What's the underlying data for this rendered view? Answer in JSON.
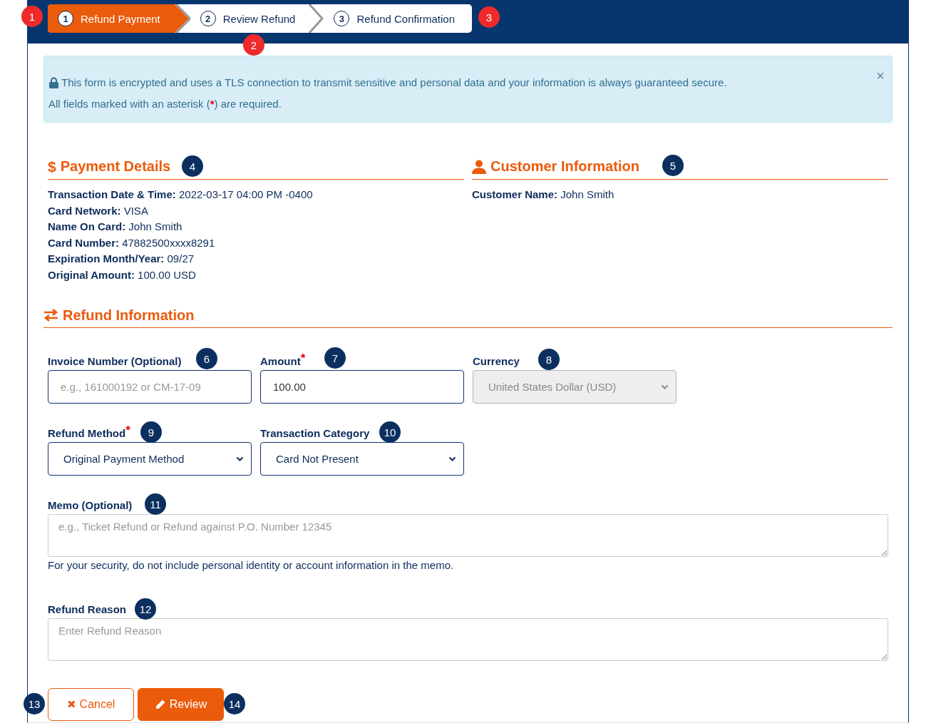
{
  "steps": [
    {
      "number": "1",
      "label": "Refund Payment",
      "selected": true
    },
    {
      "number": "2",
      "label": "Review Refund",
      "selected": false
    },
    {
      "number": "3",
      "label": "Refund Confirmation",
      "selected": false
    }
  ],
  "alert": {
    "text": "This form is encrypted and uses a TLS connection to transmit sensitive and personal data and your information is always guaranteed secure.",
    "required_before": "All fields marked with an asterisk (",
    "required_mark": "*",
    "required_after": ") are required.",
    "close": "×"
  },
  "payment_details": {
    "icon": "$",
    "title": "Payment Details",
    "rows": [
      {
        "label": "Transaction Date & Time:",
        "value": "2022-03-17 04:00 PM -0400"
      },
      {
        "label": "Card Network:",
        "value": "VISA"
      },
      {
        "label": "Name On Card:",
        "value": "John Smith"
      },
      {
        "label": "Card Number:",
        "value": "47882500xxxx8291"
      },
      {
        "label": "Expiration Month/Year:",
        "value": "09/27"
      },
      {
        "label": "Original Amount:",
        "value": "100.00 USD"
      }
    ]
  },
  "customer_information": {
    "title": "Customer Information",
    "rows": [
      {
        "label": "Customer Name:",
        "value": "John Smith"
      }
    ]
  },
  "refund_information": {
    "title": "Refund Information"
  },
  "field_rows": [
    [
      {
        "kind": "input",
        "label": "Invoice Number (Optional)",
        "required": false,
        "placeholder": "e.g., 161000192 or CM-17-09"
      },
      {
        "kind": "input",
        "label": "Amount",
        "required": true,
        "value": "100.00"
      },
      {
        "kind": "select",
        "label": "Currency",
        "required": false,
        "value": "United States Dollar (USD)",
        "disabled": true
      }
    ],
    [
      {
        "kind": "select",
        "label": "Refund Method",
        "required": true,
        "value": "Original Payment Method",
        "disabled": false
      },
      {
        "kind": "select",
        "label": "Transaction Category",
        "required": false,
        "value": "Card Not Present",
        "disabled": false
      }
    ],
    [
      {
        "kind": "textarea",
        "label": "Memo (Optional)",
        "required": false,
        "placeholder": "e.g., Ticket Refund or Refund against P.O. Number 12345",
        "help": "For your security, do not include personal identity or account information in the memo."
      }
    ],
    [
      {
        "kind": "textarea",
        "label": "Refund Reason",
        "required": false,
        "placeholder": "Enter Refund Reason"
      }
    ]
  ],
  "buttons": [
    {
      "kind": "cancel",
      "icon": "✖",
      "label": "Cancel"
    },
    {
      "kind": "review",
      "label": "Review"
    }
  ],
  "callouts": [
    {
      "number": "1",
      "color": "#ee2a2a"
    },
    {
      "number": "2",
      "color": "#ee2a2a"
    },
    {
      "number": "3",
      "color": "#ee2a2a"
    },
    {
      "number": "4",
      "color": "#0b2f5f"
    },
    {
      "number": "5",
      "color": "#0b2f5f"
    },
    {
      "number": "6",
      "color": "#0b2f5f"
    },
    {
      "number": "7",
      "color": "#0b2f5f"
    },
    {
      "number": "8",
      "color": "#0b2f5f"
    },
    {
      "number": "9",
      "color": "#0b2f5f"
    },
    {
      "number": "10",
      "color": "#0b2f5f"
    },
    {
      "number": "11",
      "color": "#0b2f5f"
    },
    {
      "number": "12",
      "color": "#0b2f5f"
    },
    {
      "number": "13",
      "color": "#0b2f5f"
    },
    {
      "number": "14",
      "color": "#0b2f5f"
    }
  ]
}
